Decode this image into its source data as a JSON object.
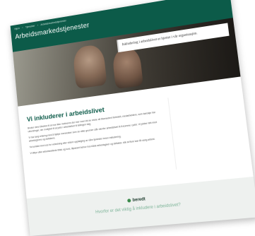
{
  "breadcrumb": [
    "Hjem",
    "Tjenester",
    "Arbeidsmarkedstjenester"
  ],
  "header": {
    "site_title": "Arbeidsmarkedstjenester",
    "tagline": "Inkludering i arbeidslivet er hjertet i vår organisasjon."
  },
  "main": {
    "heading": "Vi inkluderer i arbeidslivet",
    "paragraphs": [
      "Bruker dere Eiksikra til at noe ikke motiveres der mer noen tid av rekke alt tilsenedent forbidelt, medarbeidere, som kanskje har utfordringer, der mulighet til at jobb i arbeidslivet til tellingen dag.",
      "Vi har lang erfaring med å hjelpe mennesker som av ulike grunner står utenfor arbeidslivet til å komme i jobb. Vi jobber tett med arbeidsgivere og deltakere.",
      "Ta kontakt med oss for veiledning eller videre oppfølging av våre tjenester innen inkludering.",
      "Vi tilbyr ulike arbeidsrettede tiltak og kurs, tilpasset behov hos både arbeidsgiver og deltaker, slik at flere kan få varig arbeid."
    ]
  },
  "footer": {
    "brand": "beredt",
    "link": "Hvorfor er det viktig å inkludere i arbeidslivet?"
  },
  "colors": {
    "header_green": "#0c5b49",
    "heading_green": "#0c5b49",
    "footer_bg": "#eef1ef",
    "footer_link": "#7fb59a"
  }
}
